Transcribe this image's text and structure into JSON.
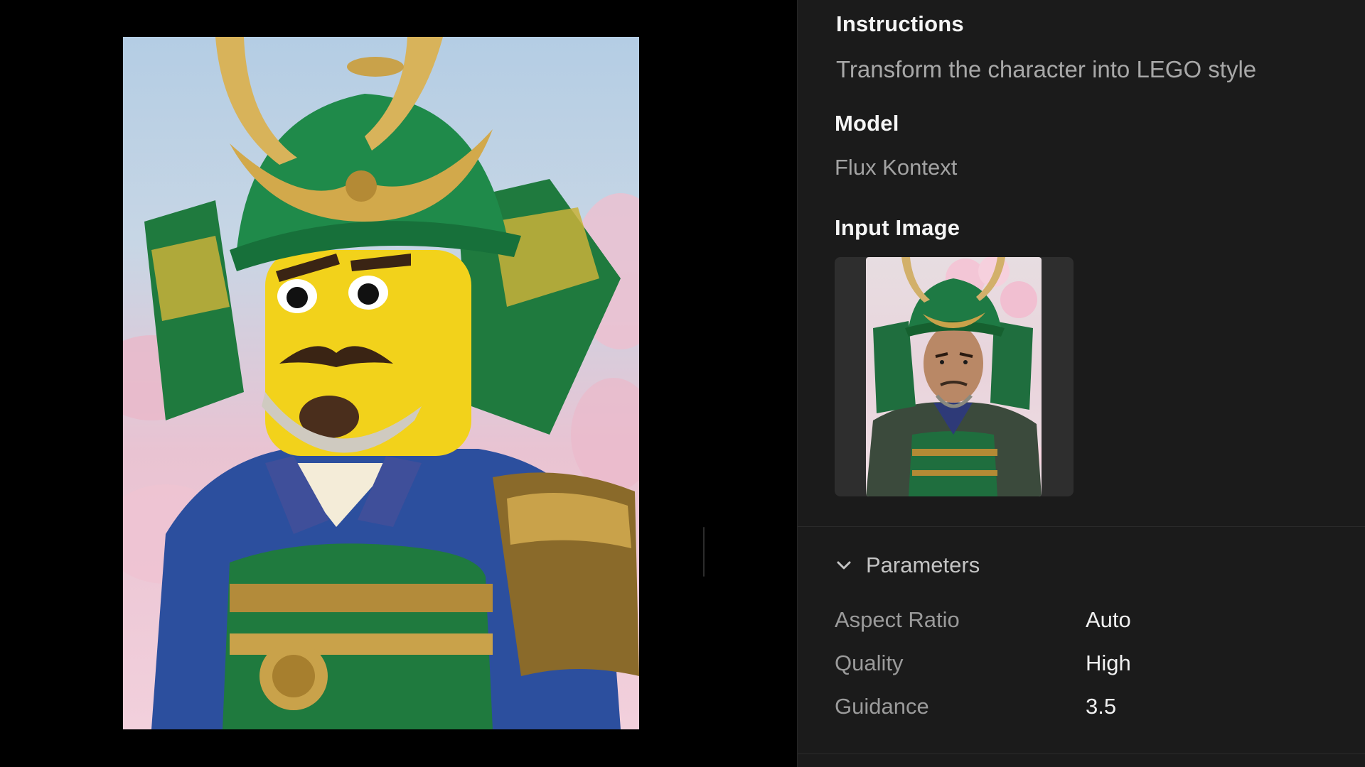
{
  "instructions": {
    "heading": "Instructions",
    "text": "Transform the character into LEGO style"
  },
  "model": {
    "heading": "Model",
    "value": "Flux Kontext"
  },
  "input_image": {
    "heading": "Input Image"
  },
  "parameters": {
    "toggle_label": "Parameters",
    "expanded": true,
    "rows": [
      {
        "name": "Aspect Ratio",
        "value": "Auto"
      },
      {
        "name": "Quality",
        "value": "High"
      },
      {
        "name": "Guidance",
        "value": "3.5"
      }
    ]
  },
  "colors": {
    "panel_bg": "#1b1b1b",
    "canvas_bg": "#000000",
    "heading_text": "#f5f5f5",
    "muted_text": "#a3a3a3",
    "armor_green": "#1f7a3e",
    "armor_gold": "#c9a24a",
    "lego_yellow": "#f2d21b",
    "armor_blue": "#2c4f9e"
  },
  "icons": {
    "parameters_toggle": "chevron-down-icon"
  }
}
